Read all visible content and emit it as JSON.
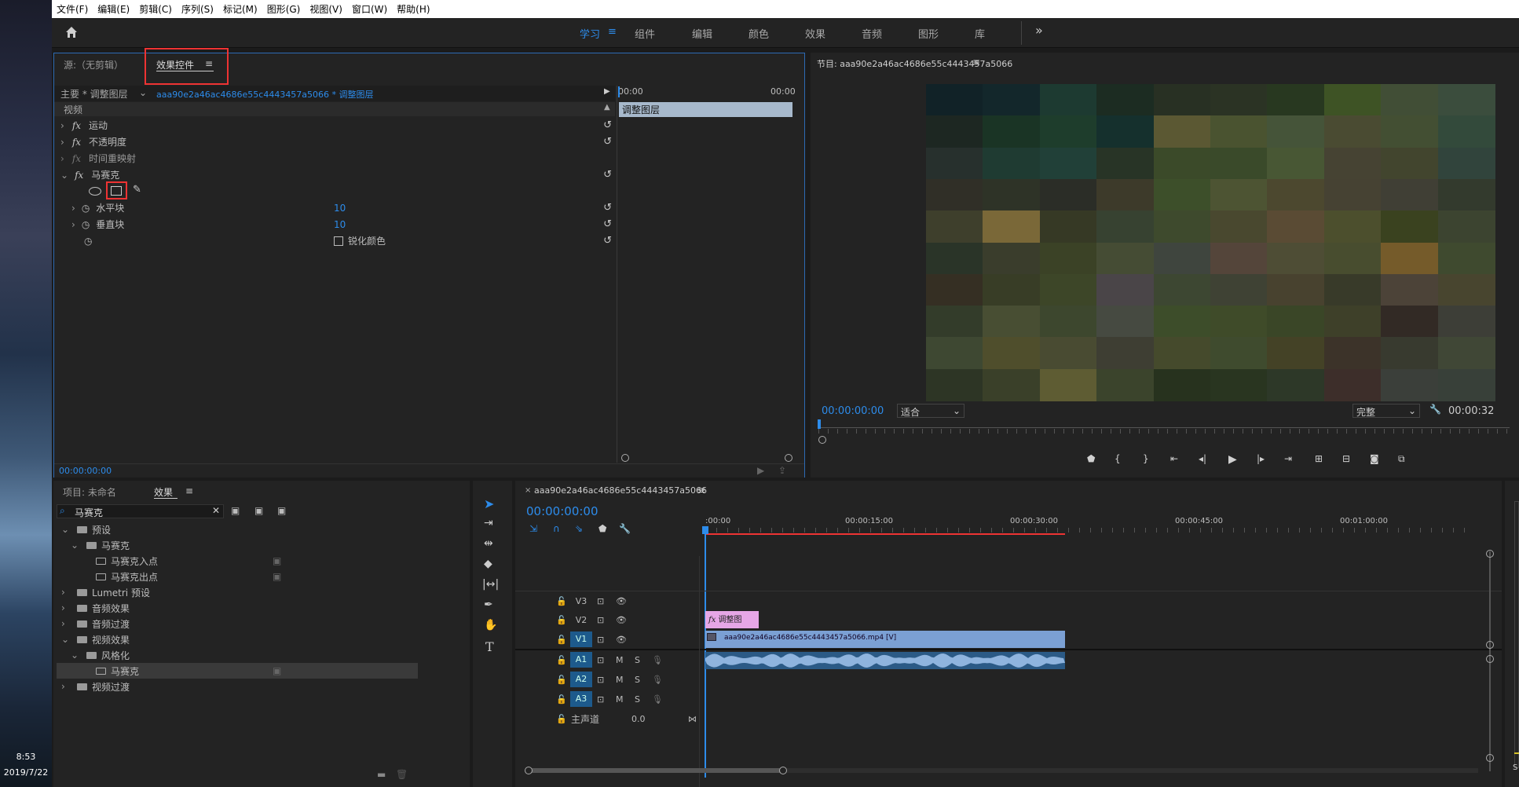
{
  "desktop": {
    "time": "8:53",
    "date": "2019/7/22"
  },
  "menu": [
    "文件(F)",
    "编辑(E)",
    "剪辑(C)",
    "序列(S)",
    "标记(M)",
    "图形(G)",
    "视图(V)",
    "窗口(W)",
    "帮助(H)"
  ],
  "workspaces": {
    "active": "学习",
    "tabs": [
      "组件",
      "编辑",
      "颜色",
      "效果",
      "音频",
      "图形",
      "库"
    ],
    "more": "»"
  },
  "source_panel": {
    "tab_source": "源:（无剪辑）",
    "tab_effects": "效果控件",
    "menu_icon": "≡"
  },
  "effect_controls": {
    "header_master": "主要 * 调整图层",
    "header_clip": "aaa90e2a46ac4686e55c4443457a5066 * 调整图层",
    "time_start": "00:00",
    "time_end": "00:00",
    "clip_label": "调整图层",
    "section": "视频",
    "effects": [
      {
        "fx": "fx",
        "name": "运动"
      },
      {
        "fx": "fx",
        "name": "不透明度"
      },
      {
        "fx": "fx",
        "name": "时间重映射"
      },
      {
        "fx": "fx",
        "name": "马赛克"
      }
    ],
    "params": [
      {
        "name": "水平块",
        "value": "10"
      },
      {
        "name": "垂直块",
        "value": "10"
      }
    ],
    "sharpen_label": "锐化颜色",
    "timecode": "00:00:00:00"
  },
  "program": {
    "title": "节目: aaa90e2a46ac4686e55c4443457a5066",
    "menu_icon": "≡",
    "timecode": "00:00:00:00",
    "fit": "适合",
    "quality": "完整",
    "duration": "00:00:32"
  },
  "mosaic_colors": [
    [
      "#112227",
      "#13272b",
      "#1d3a31",
      "#1c2c22",
      "#283023",
      "#2b3324",
      "#283820",
      "#3e5325",
      "#414e36",
      "#3b4d3d"
    ],
    [
      "#1d2722",
      "#1a3425",
      "#1e3d2c",
      "#15302d",
      "#5b5833",
      "#4a5330",
      "#455439",
      "#4a4b32",
      "#434f33",
      "#334a3b"
    ],
    [
      "#27302d",
      "#1f3b32",
      "#214038",
      "#283426",
      "#3b4a29",
      "#3a4a2a",
      "#485734",
      "#464333",
      "#42452e",
      "#31443c"
    ],
    [
      "#302f27",
      "#2e3327",
      "#2b2d27",
      "#3d3a2a",
      "#3d4f2a",
      "#4d5433",
      "#4c482f",
      "#464233",
      "#403f35",
      "#333a2d"
    ],
    [
      "#3e3f2c",
      "#7a6838",
      "#363925",
      "#374231",
      "#3e4a2d",
      "#49482f",
      "#5a4b34",
      "#4c4f2d",
      "#3a421f",
      "#3c4430"
    ],
    [
      "#2a3428",
      "#3a3d2c",
      "#3b4226",
      "#454c34",
      "#3f453e",
      "#54453a",
      "#4e4d35",
      "#484d2f",
      "#755b2a",
      "#3f4a2f"
    ],
    [
      "#352f23",
      "#383d26",
      "#3d4628",
      "#4a4548",
      "#3d4732",
      "#3f4234",
      "#48422f",
      "#383a29",
      "#4c4338",
      "#48452f"
    ],
    [
      "#333c2a",
      "#484e33",
      "#3d472e",
      "#464a41",
      "#3d4d2a",
      "#3f4b29",
      "#3a4627",
      "#3e4029",
      "#322a25",
      "#3d3e37"
    ],
    [
      "#3e4832",
      "#4f4e2c",
      "#494b32",
      "#3e3e33",
      "#454a2c",
      "#3f4b2e",
      "#444226",
      "#3c3329",
      "#383a2f",
      "#404736"
    ],
    [
      "#2d3525",
      "#3a4029",
      "#5e5c33",
      "#3b442c",
      "#27321e",
      "#293520",
      "#2d3828",
      "#3d2e2a",
      "#3b3f3a",
      "#384039"
    ]
  ],
  "project": {
    "tab_project": "项目: 未命名",
    "tab_effects": "效果",
    "search": "马赛克",
    "tree": [
      {
        "label": "预设",
        "indent": 0,
        "arrow": "⌄",
        "type": "folder"
      },
      {
        "label": "马赛克",
        "indent": 1,
        "arrow": "⌄",
        "type": "folder"
      },
      {
        "label": "马赛克入点",
        "indent": 2,
        "arrow": "",
        "type": "preset"
      },
      {
        "label": "马赛克出点",
        "indent": 2,
        "arrow": "",
        "type": "preset"
      },
      {
        "label": "Lumetri 预设",
        "indent": 0,
        "arrow": "›",
        "type": "folder"
      },
      {
        "label": "音频效果",
        "indent": 0,
        "arrow": "›",
        "type": "folder"
      },
      {
        "label": "音频过渡",
        "indent": 0,
        "arrow": "›",
        "type": "folder"
      },
      {
        "label": "视频效果",
        "indent": 0,
        "arrow": "⌄",
        "type": "folder"
      },
      {
        "label": "风格化",
        "indent": 1,
        "arrow": "⌄",
        "type": "folder"
      },
      {
        "label": "马赛克",
        "indent": 2,
        "arrow": "",
        "type": "effect"
      },
      {
        "label": "视频过渡",
        "indent": 0,
        "arrow": "›",
        "type": "folder"
      }
    ]
  },
  "timeline": {
    "tab": "aaa90e2a46ac4686e55c4443457a5066",
    "timecode": "00:00:00:00",
    "ruler": [
      ":00:00",
      "00:00:15:00",
      "00:00:30:00",
      "00:00:45:00",
      "00:01:00:00"
    ],
    "video_tracks": [
      "V3",
      "V2",
      "V1"
    ],
    "audio_tracks": [
      "A1",
      "A2",
      "A3"
    ],
    "master": "主声道",
    "master_value": "0.0",
    "adj_clip": "调整图",
    "video_clip": "aaa90e2a46ac4686e55c4443457a5066.mp4 [V]"
  },
  "audio_meter": {
    "left": "S",
    "right": "S"
  }
}
